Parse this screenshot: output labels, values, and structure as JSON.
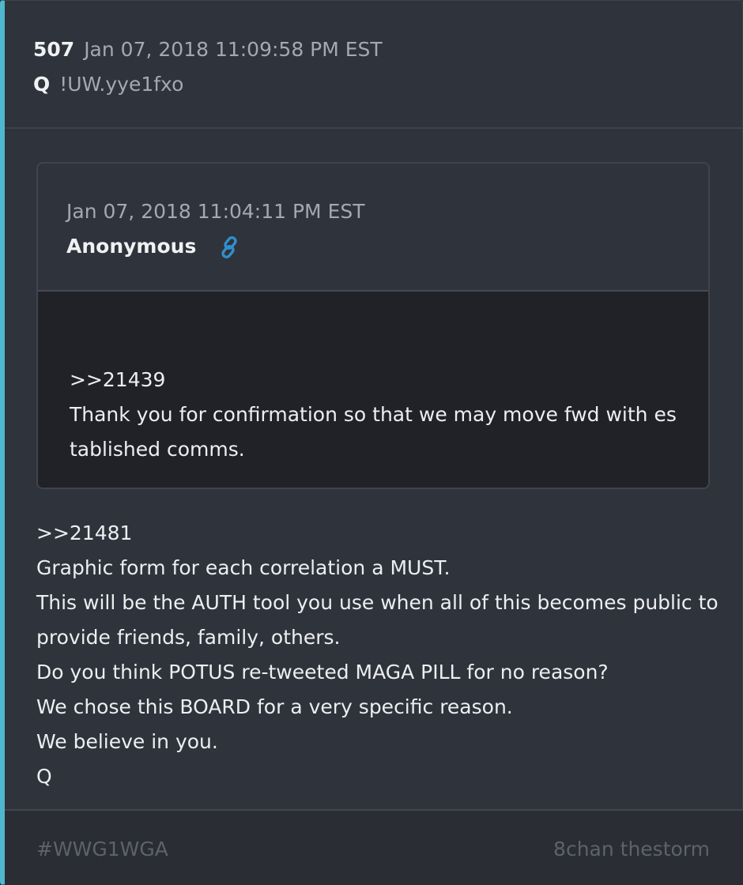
{
  "post": {
    "number": "507",
    "timestamp": "Jan 07, 2018 11:09:58 PM EST",
    "author": "Q",
    "tripcode": "!UW.yye1fxo",
    "accent_color": "#4fb8cf"
  },
  "quoted_post": {
    "timestamp": "Jan 07, 2018 11:04:11 PM EST",
    "author": "Anonymous",
    "link_icon": "link-icon",
    "link_color": "#2f8fcf",
    "lines": [
      ">>21439",
      "Thank you for confirmation so that we may move fwd with es",
      "tablished comms."
    ]
  },
  "message": {
    "lines": [
      ">>21481",
      "Graphic form for each correlation a MUST.",
      "This will be the AUTH tool you use when all of this becomes public to",
      "provide friends, family, others.",
      "Do you think POTUS re-tweeted MAGA PILL for no reason?",
      "We chose this BOARD for a very specific reason.",
      "We believe in you.",
      "Q"
    ]
  },
  "footer": {
    "hashtag": "#WWG1WGA",
    "source": "8chan thestorm"
  }
}
